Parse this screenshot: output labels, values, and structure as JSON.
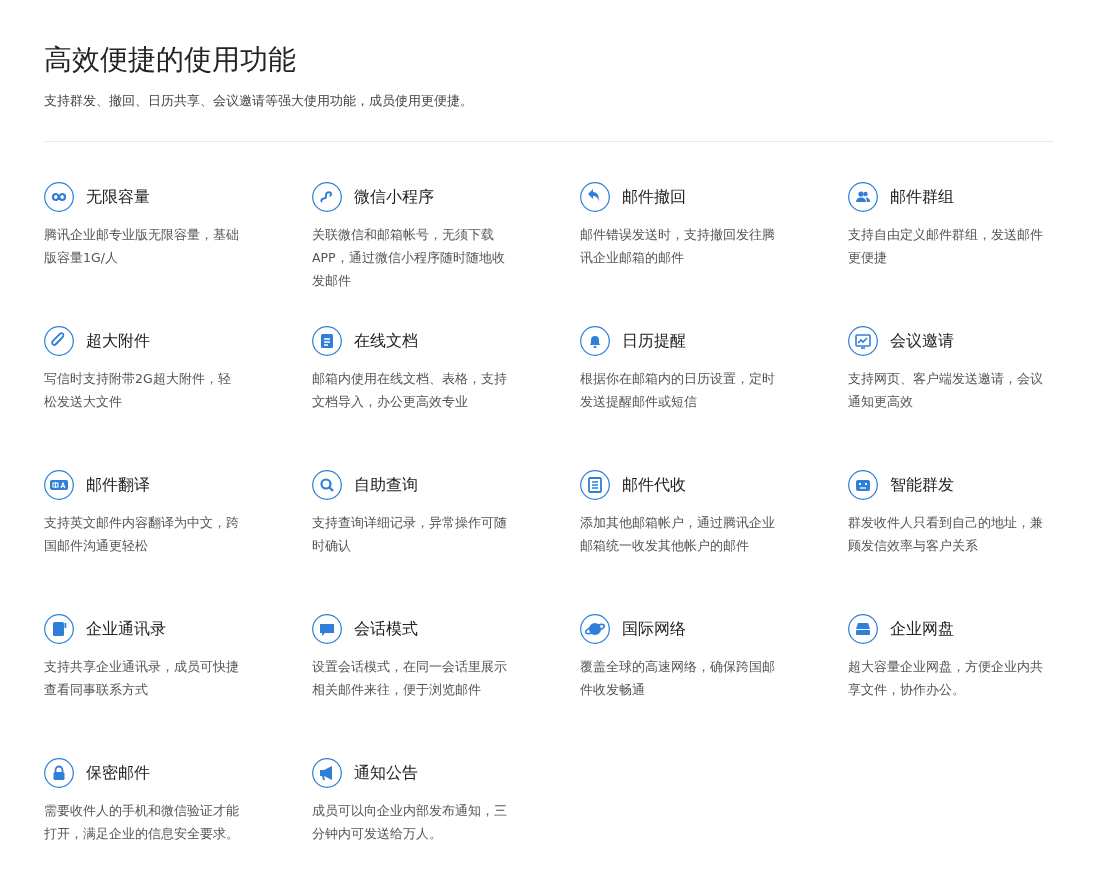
{
  "title": "高效便捷的使用功能",
  "subtitle": "支持群发、撤回、日历共享、会议邀请等强大使用功能，成员使用更便捷。",
  "features": [
    {
      "title": "无限容量",
      "description": "腾讯企业邮专业版无限容量，基础版容量1G/人"
    },
    {
      "title": "微信小程序",
      "description": "关联微信和邮箱帐号，无须下载APP，通过微信小程序随时随地收发邮件"
    },
    {
      "title": "邮件撤回",
      "description": "邮件错误发送时，支持撤回发往腾讯企业邮箱的邮件"
    },
    {
      "title": "邮件群组",
      "description": "支持自由定义邮件群组，发送邮件更便捷"
    },
    {
      "title": "超大附件",
      "description": "写信时支持附带2G超大附件，轻松发送大文件"
    },
    {
      "title": "在线文档",
      "description": "邮箱内使用在线文档、表格，支持文档导入，办公更高效专业"
    },
    {
      "title": "日历提醒",
      "description": "根据你在邮箱内的日历设置，定时发送提醒邮件或短信"
    },
    {
      "title": "会议邀请",
      "description": "支持网页、客户端发送邀请，会议通知更高效"
    },
    {
      "title": "邮件翻译",
      "description": "支持英文邮件内容翻译为中文，跨国邮件沟通更轻松"
    },
    {
      "title": "自助查询",
      "description": "支持查询详细记录，异常操作可随时确认"
    },
    {
      "title": "邮件代收",
      "description": "添加其他邮箱帐户，通过腾讯企业邮箱统一收发其他帐户的邮件"
    },
    {
      "title": "智能群发",
      "description": "群发收件人只看到自己的地址，兼顾发信效率与客户关系"
    },
    {
      "title": "企业通讯录",
      "description": "支持共享企业通讯录，成员可快捷查看同事联系方式"
    },
    {
      "title": "会话模式",
      "description": "设置会话模式，在同一会话里展示相关邮件来往，便于浏览邮件"
    },
    {
      "title": "国际网络",
      "description": "覆盖全球的高速网络，确保跨国邮件收发畅通"
    },
    {
      "title": "企业网盘",
      "description": "超大容量企业网盘，方便企业内共享文件，协作办公。"
    },
    {
      "title": "保密邮件",
      "description": "需要收件人的手机和微信验证才能打开，满足企业的信息安全要求。"
    },
    {
      "title": "通知公告",
      "description": "成员可以向企业内部发布通知，三分钟内可发送给万人。"
    }
  ]
}
